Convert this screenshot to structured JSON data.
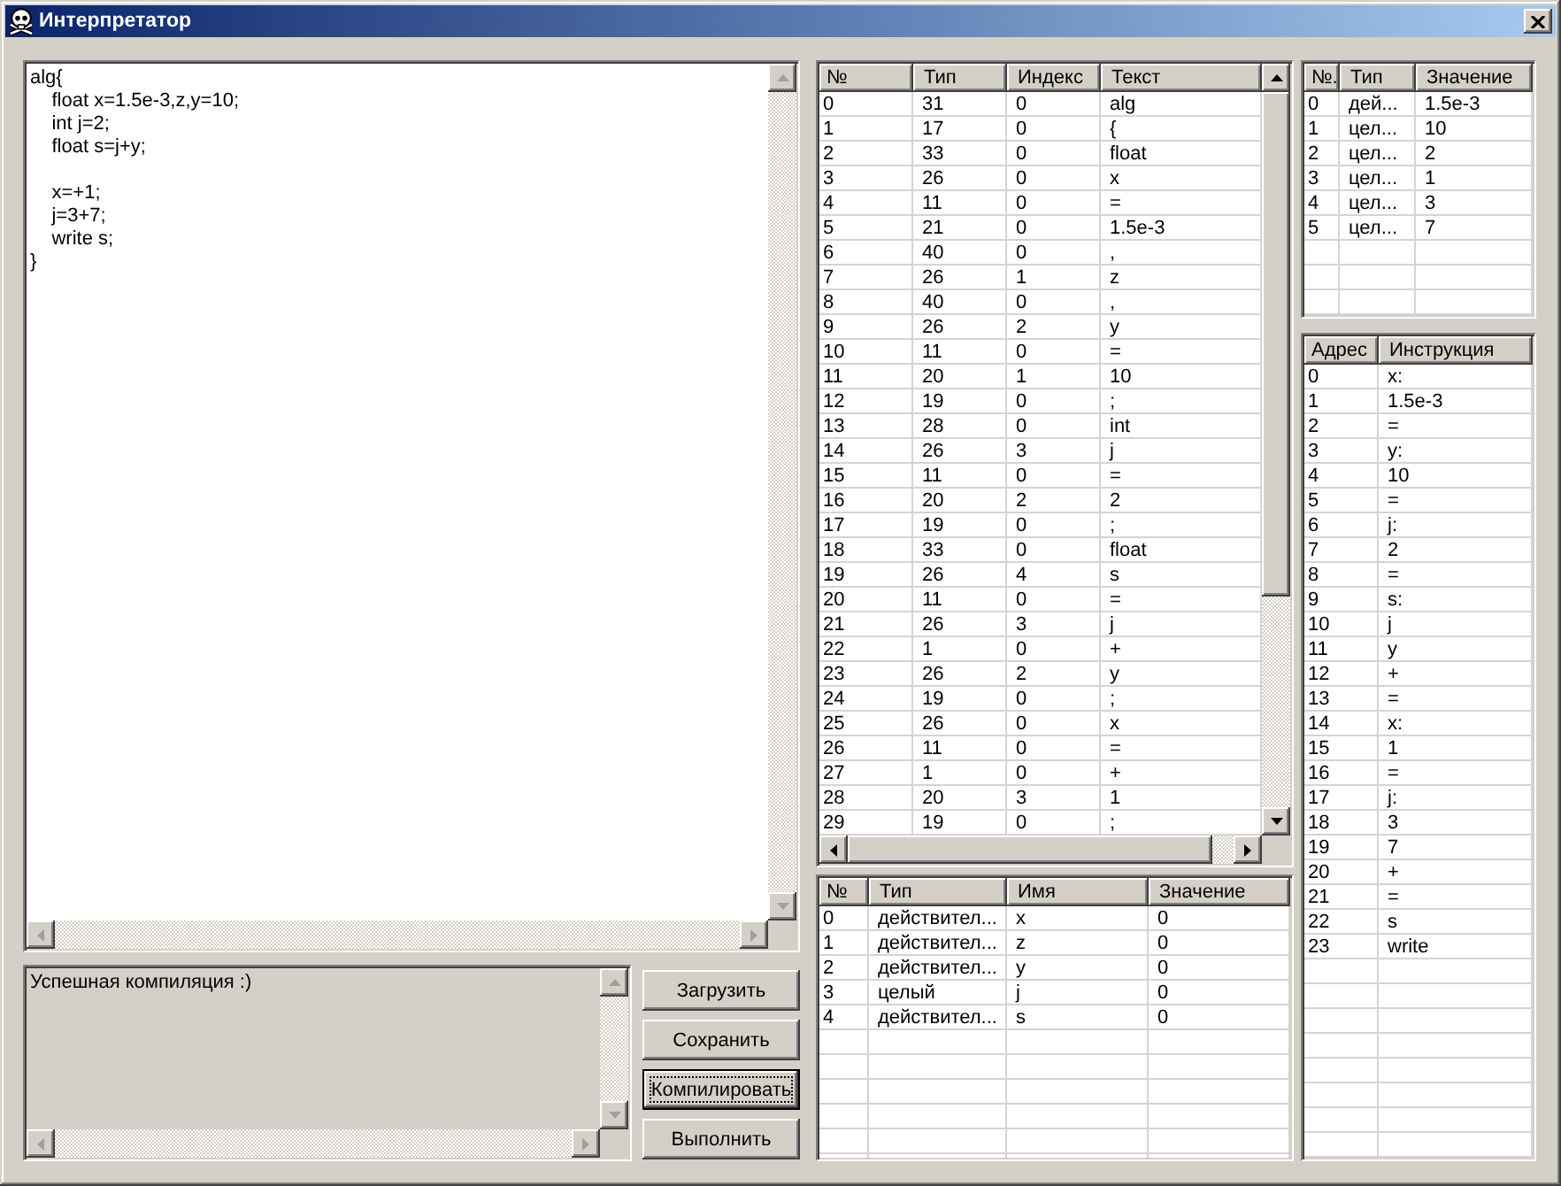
{
  "window": {
    "title": "Интерпретатор"
  },
  "editor": {
    "value": "alg{\n    float x=1.5e-3,z,y=10;\n    int j=2;\n    float s=j+y;\n\n    x=+1;\n    j=3+7;\n    write s;\n}"
  },
  "output": {
    "value": "Успешная компиляция :)"
  },
  "buttons": [
    {
      "label": "Загрузить",
      "focused": false
    },
    {
      "label": "Сохранить",
      "focused": false
    },
    {
      "label": "Компилировать",
      "focused": true
    },
    {
      "label": "Выполнить",
      "focused": false
    }
  ],
  "tokens_table": {
    "columns": [
      "№",
      "Тип",
      "Индекс",
      "Текст"
    ],
    "rows": [
      [
        "0",
        "31",
        "0",
        "alg"
      ],
      [
        "1",
        "17",
        "0",
        "{"
      ],
      [
        "2",
        "33",
        "0",
        "float"
      ],
      [
        "3",
        "26",
        "0",
        "x"
      ],
      [
        "4",
        "11",
        "0",
        "="
      ],
      [
        "5",
        "21",
        "0",
        "1.5e-3"
      ],
      [
        "6",
        "40",
        "0",
        ","
      ],
      [
        "7",
        "26",
        "1",
        "z"
      ],
      [
        "8",
        "40",
        "0",
        ","
      ],
      [
        "9",
        "26",
        "2",
        "y"
      ],
      [
        "10",
        "11",
        "0",
        "="
      ],
      [
        "11",
        "20",
        "1",
        "10"
      ],
      [
        "12",
        "19",
        "0",
        ";"
      ],
      [
        "13",
        "28",
        "0",
        "int"
      ],
      [
        "14",
        "26",
        "3",
        "j"
      ],
      [
        "15",
        "11",
        "0",
        "="
      ],
      [
        "16",
        "20",
        "2",
        "2"
      ],
      [
        "17",
        "19",
        "0",
        ";"
      ],
      [
        "18",
        "33",
        "0",
        "float"
      ],
      [
        "19",
        "26",
        "4",
        "s"
      ],
      [
        "20",
        "11",
        "0",
        "="
      ],
      [
        "21",
        "26",
        "3",
        "j"
      ],
      [
        "22",
        "1",
        "0",
        "+"
      ],
      [
        "23",
        "26",
        "2",
        "y"
      ],
      [
        "24",
        "19",
        "0",
        ";"
      ],
      [
        "25",
        "26",
        "0",
        "x"
      ],
      [
        "26",
        "11",
        "0",
        "="
      ],
      [
        "27",
        "1",
        "0",
        "+"
      ],
      [
        "28",
        "20",
        "3",
        "1"
      ],
      [
        "29",
        "19",
        "0",
        ";"
      ]
    ]
  },
  "variables_table": {
    "columns": [
      "№",
      "Тип",
      "Имя",
      "Значение"
    ],
    "rows": [
      [
        "0",
        "действител...",
        "x",
        "0"
      ],
      [
        "1",
        "действител...",
        "z",
        "0"
      ],
      [
        "2",
        "действител...",
        "y",
        "0"
      ],
      [
        "3",
        "целый",
        "j",
        "0"
      ],
      [
        "4",
        "действител...",
        "s",
        "0"
      ]
    ]
  },
  "constants_table": {
    "columns": [
      "№.",
      "Тип",
      "Значение"
    ],
    "rows": [
      [
        "0",
        "дей...",
        "1.5e-3"
      ],
      [
        "1",
        "цел...",
        "10"
      ],
      [
        "2",
        "цел...",
        "2"
      ],
      [
        "3",
        "цел...",
        "1"
      ],
      [
        "4",
        "цел...",
        "3"
      ],
      [
        "5",
        "цел...",
        "7"
      ]
    ]
  },
  "instructions_table": {
    "columns": [
      "Адрес",
      "Инструкция"
    ],
    "rows": [
      [
        "0",
        "x:"
      ],
      [
        "1",
        "1.5e-3"
      ],
      [
        "2",
        "="
      ],
      [
        "3",
        "y:"
      ],
      [
        "4",
        "10"
      ],
      [
        "5",
        "="
      ],
      [
        "6",
        "j:"
      ],
      [
        "7",
        "2"
      ],
      [
        "8",
        "="
      ],
      [
        "9",
        "s:"
      ],
      [
        "10",
        "j"
      ],
      [
        "11",
        "y"
      ],
      [
        "12",
        "+"
      ],
      [
        "13",
        "="
      ],
      [
        "14",
        "x:"
      ],
      [
        "15",
        "1"
      ],
      [
        "16",
        "="
      ],
      [
        "17",
        "j:"
      ],
      [
        "18",
        "3"
      ],
      [
        "19",
        "7"
      ],
      [
        "20",
        "+"
      ],
      [
        "21",
        "="
      ],
      [
        "22",
        "s"
      ],
      [
        "23",
        "write"
      ]
    ]
  }
}
